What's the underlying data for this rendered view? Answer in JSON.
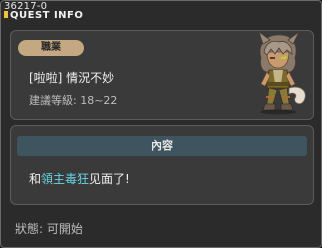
{
  "window": {
    "quest_id": "36217-0",
    "title": "QUEST INFO"
  },
  "info": {
    "job_label": "職業",
    "quest_name": "[啦啦] 情況不妙",
    "level_text": "建議等級: 18~22"
  },
  "content": {
    "header": "內容",
    "body_prefix": "和",
    "npc_name": "領主毒狂",
    "body_suffix": "见面了!"
  },
  "status": {
    "text": "狀態: 可開始"
  },
  "colors": {
    "accent_npc_name": "#67d4e6",
    "job_pill": "#c4a882",
    "content_header": "#3e5560"
  }
}
